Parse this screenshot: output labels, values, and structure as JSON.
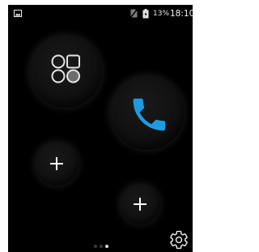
{
  "statusbar": {
    "battery_percent": "13%",
    "time": "18:10",
    "icons": [
      "notification-image-icon",
      "no-sim-icon",
      "battery-charging-icon"
    ]
  },
  "home": {
    "app_drawer": {
      "icon": "apps-grid-icon"
    },
    "dock_app": {
      "icon": "phone-icon",
      "color": "#1e9be0"
    },
    "empty_slots": [
      {
        "icon": "plus-icon"
      },
      {
        "icon": "plus-icon"
      }
    ],
    "pages": {
      "count": 3,
      "current": 3
    },
    "settings": {
      "icon": "settings-gear-icon"
    }
  },
  "colors": {
    "background": "#000000",
    "accent": "#1e9be0",
    "foreground": "#ffffff"
  }
}
